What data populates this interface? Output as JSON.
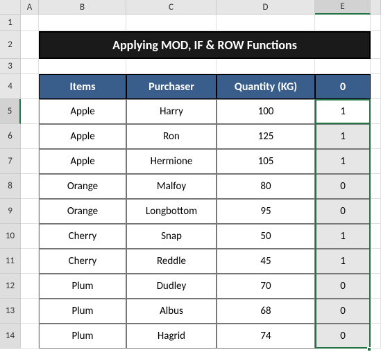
{
  "columns": [
    "A",
    "B",
    "C",
    "D",
    "E"
  ],
  "rows": [
    "1",
    "2",
    "3",
    "4",
    "5",
    "6",
    "7",
    "8",
    "9",
    "10",
    "11",
    "12",
    "13",
    "14"
  ],
  "title": "Applying MOD, IF & ROW Functions",
  "headers": {
    "items": "Items",
    "purchaser": "Purchaser",
    "quantity": "Quantity (KG)",
    "flag": "0"
  },
  "data": [
    {
      "item": "Apple",
      "purchaser": "Harry",
      "qty": "100",
      "flag": "1"
    },
    {
      "item": "Apple",
      "purchaser": "Ron",
      "qty": "125",
      "flag": "1"
    },
    {
      "item": "Apple",
      "purchaser": "Hermione",
      "qty": "105",
      "flag": "1"
    },
    {
      "item": "Orange",
      "purchaser": "Malfoy",
      "qty": "80",
      "flag": "0"
    },
    {
      "item": "Orange",
      "purchaser": "Longbottom",
      "qty": "95",
      "flag": "0"
    },
    {
      "item": "Cherry",
      "purchaser": "Snap",
      "qty": "50",
      "flag": "1"
    },
    {
      "item": "Cherry",
      "purchaser": "Reddle",
      "qty": "45",
      "flag": "1"
    },
    {
      "item": "Plum",
      "purchaser": "Dudley",
      "qty": "70",
      "flag": "0"
    },
    {
      "item": "Plum",
      "purchaser": "Albus",
      "qty": "68",
      "flag": "0"
    },
    {
      "item": "Plum",
      "purchaser": "Hagrid",
      "qty": "74",
      "flag": "0"
    }
  ],
  "chart_data": {
    "type": "table",
    "title": "Applying MOD, IF & ROW Functions",
    "columns": [
      "Items",
      "Purchaser",
      "Quantity (KG)",
      "0"
    ],
    "rows": [
      [
        "Apple",
        "Harry",
        100,
        1
      ],
      [
        "Apple",
        "Ron",
        125,
        1
      ],
      [
        "Apple",
        "Hermione",
        105,
        1
      ],
      [
        "Orange",
        "Malfoy",
        80,
        0
      ],
      [
        "Orange",
        "Longbottom",
        95,
        0
      ],
      [
        "Cherry",
        "Snap",
        50,
        1
      ],
      [
        "Cherry",
        "Reddle",
        45,
        1
      ],
      [
        "Plum",
        "Dudley",
        70,
        0
      ],
      [
        "Plum",
        "Albus",
        68,
        0
      ],
      [
        "Plum",
        "Hagrid",
        74,
        0
      ]
    ]
  }
}
